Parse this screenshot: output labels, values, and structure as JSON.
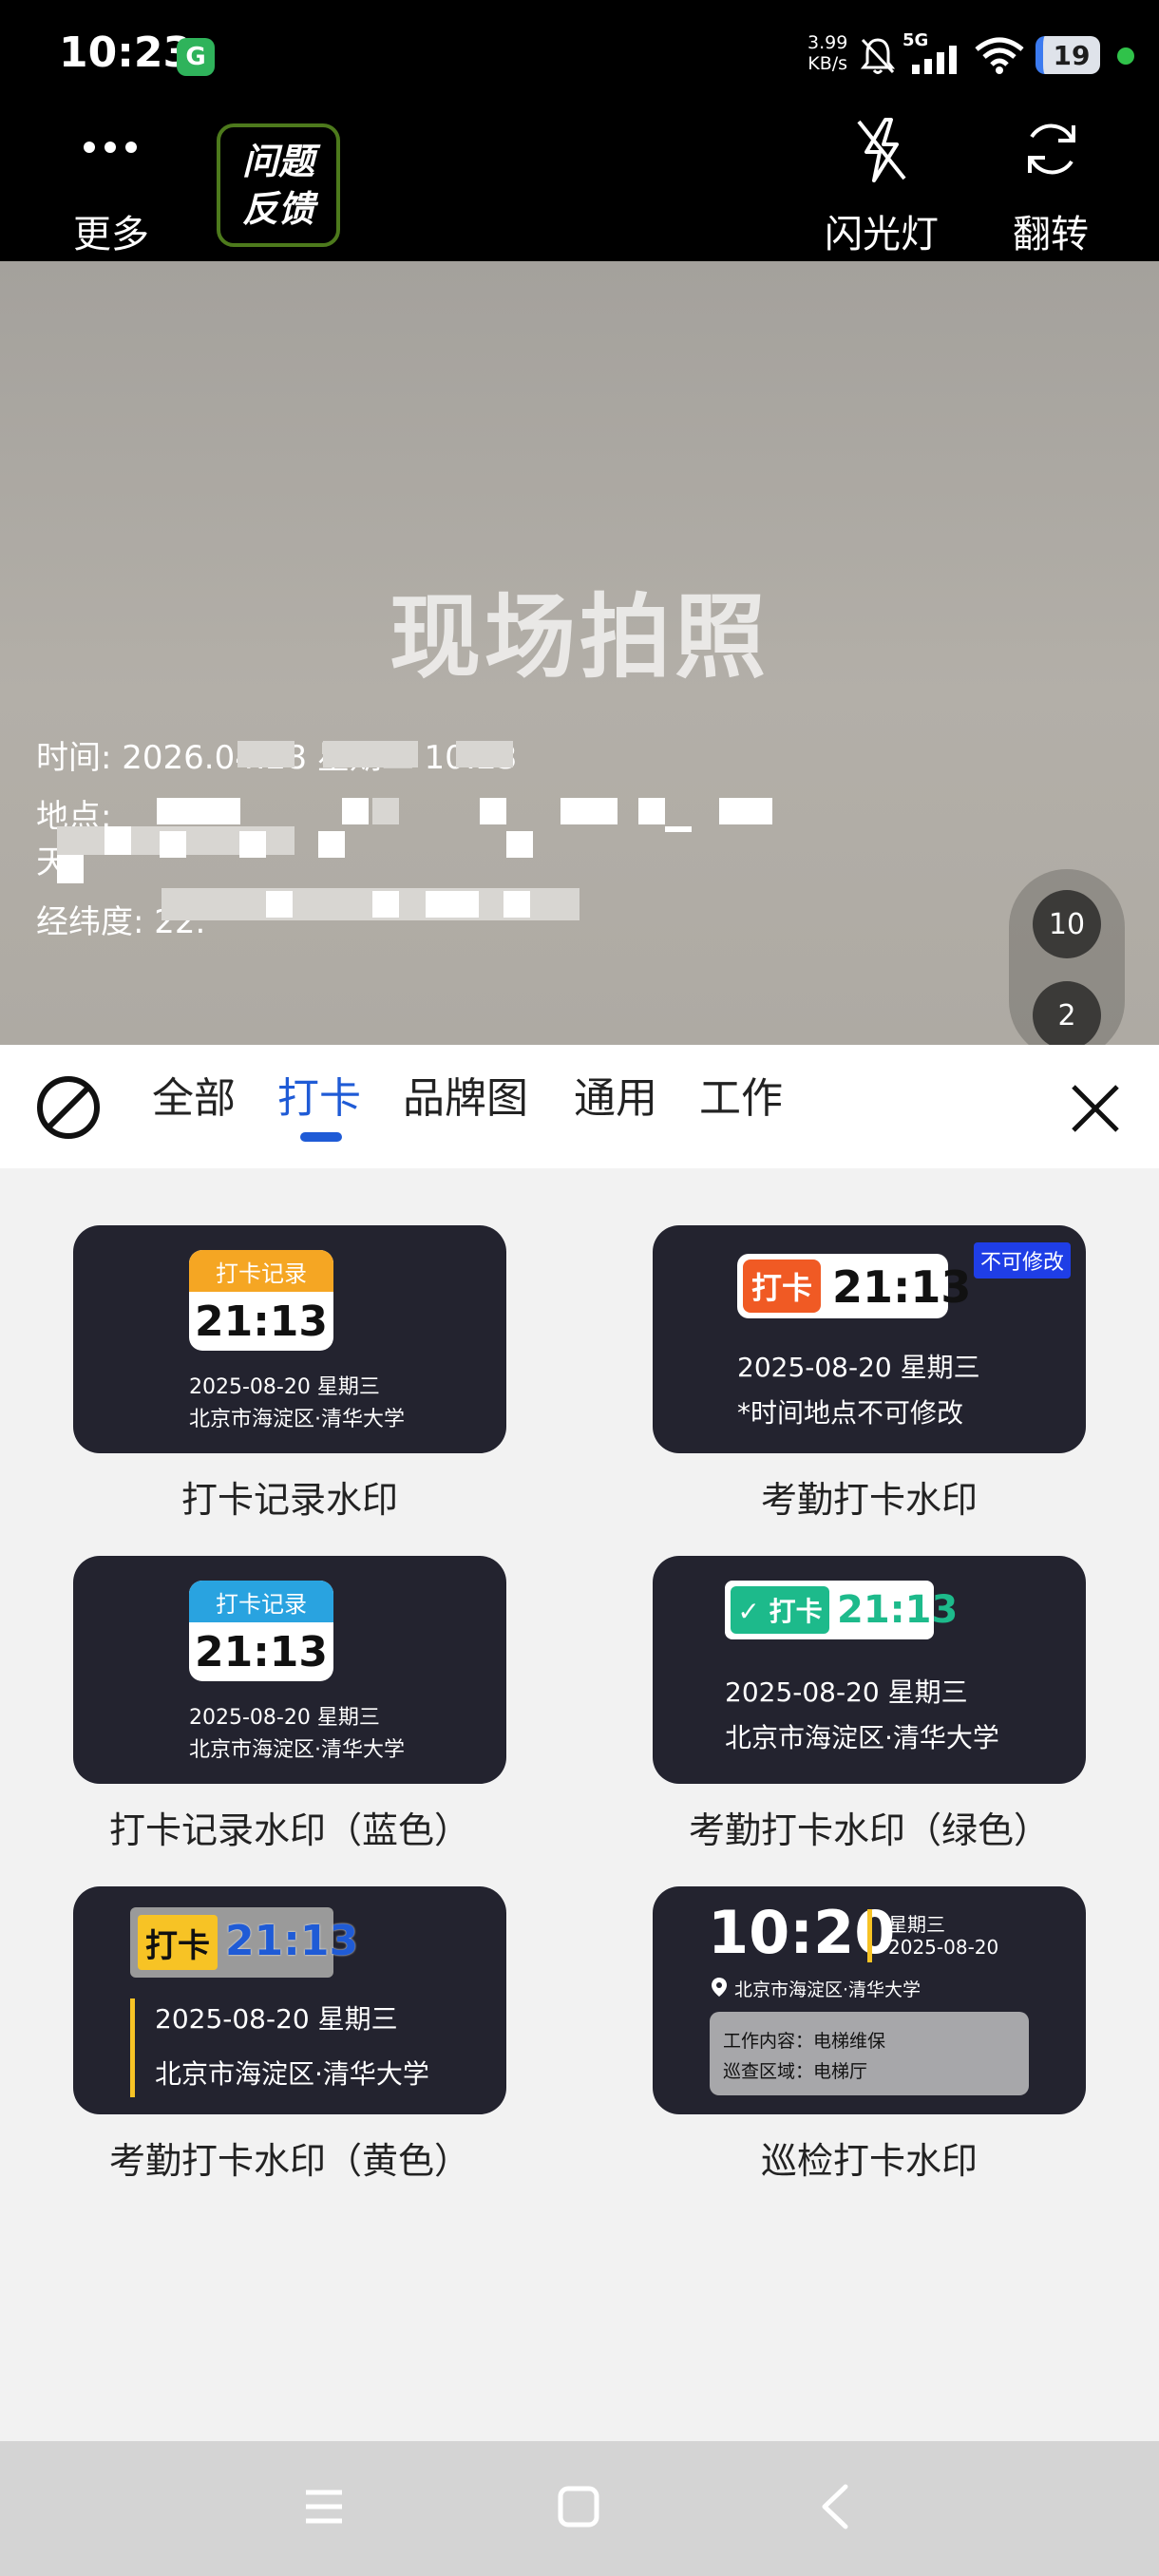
{
  "status_bar": {
    "time": "10:23",
    "app_icon_letter": "G",
    "net_speed_value": "3.99",
    "net_speed_unit": "KB/s",
    "network": "5G",
    "battery": "19"
  },
  "top_bar": {
    "more_label": "更多",
    "feedback_line1": "问题",
    "feedback_line2": "反馈",
    "flash_label": "闪光灯",
    "flip_label": "翻转"
  },
  "camera": {
    "title": "现场拍照",
    "wm_time": "时间: 2026.04.28 星期二 10:23",
    "wm_location": "地点:",
    "wm_weather": "天",
    "wm_coords": "经纬度: 22.",
    "zoom_values": [
      "10",
      "2"
    ]
  },
  "tabs": {
    "items": [
      "全部",
      "打卡",
      "品牌图",
      "通用",
      "工作"
    ],
    "active": "打卡"
  },
  "templates": {
    "t1": {
      "tag": "打卡记录",
      "time": "21:13",
      "date": "2025-08-20 星期三",
      "place": "北京市海淀区·清华大学",
      "label": "打卡记录水印",
      "tag_color": "#f5a623"
    },
    "t2": {
      "tag": "打卡",
      "time": "21:13",
      "badge": "不可修改",
      "date": "2025-08-20 星期三",
      "note": "*时间地点不可修改",
      "label": "考勤打卡水印",
      "tag_color": "#f05a24"
    },
    "t3": {
      "tag": "打卡记录",
      "time": "21:13",
      "date": "2025-08-20 星期三",
      "place": "北京市海淀区·清华大学",
      "label": "打卡记录水印（蓝色）",
      "tag_color": "#29a3e0"
    },
    "t4": {
      "tag": "✓ 打卡",
      "time": "21:13",
      "date": "2025-08-20 星期三",
      "place": "北京市海淀区·清华大学",
      "label": "考勤打卡水印（绿色）",
      "tag_color": "#1dba8b"
    },
    "t5": {
      "tag": "打卡",
      "time": "21:13",
      "date": "2025-08-20 星期三",
      "place": "北京市海淀区·清华大学",
      "label": "考勤打卡水印（黄色）",
      "tag_color": "#f7c325"
    },
    "t6": {
      "time": "10:20",
      "weekday": "星期三",
      "date": "2025-08-20",
      "place": "北京市海淀区·清华大学",
      "work_content": "工作内容：电梯维保",
      "patrol_area": "巡查区域：电梯厅",
      "label": "巡检打卡水印"
    }
  }
}
